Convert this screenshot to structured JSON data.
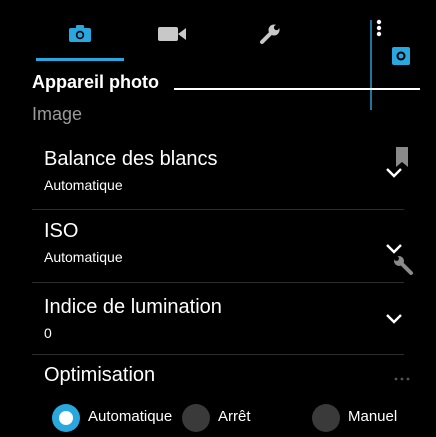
{
  "tabs": [
    {
      "name": "camera-tab",
      "icon": "camera-icon",
      "active": true
    },
    {
      "name": "video-tab",
      "icon": "video-camera-icon",
      "active": false
    },
    {
      "name": "tools-tab",
      "icon": "wrench-icon",
      "active": false
    }
  ],
  "menu_icon": "vertical-dots-icon",
  "accent_color": "#29a8e0",
  "section": {
    "title": "Appareil photo"
  },
  "subsection": {
    "title": "Image"
  },
  "settings": [
    {
      "label": "Balance des blancs",
      "value": "Automatique"
    },
    {
      "label": "ISO",
      "value": "Automatique"
    },
    {
      "label": "Indice de lumination",
      "value": "0"
    }
  ],
  "optimisation": {
    "label": "Optimisation",
    "options": [
      {
        "label": "Automatique",
        "selected": true
      },
      {
        "label": "Arrêt",
        "selected": false
      },
      {
        "label": "Manuel",
        "selected": false
      }
    ]
  }
}
